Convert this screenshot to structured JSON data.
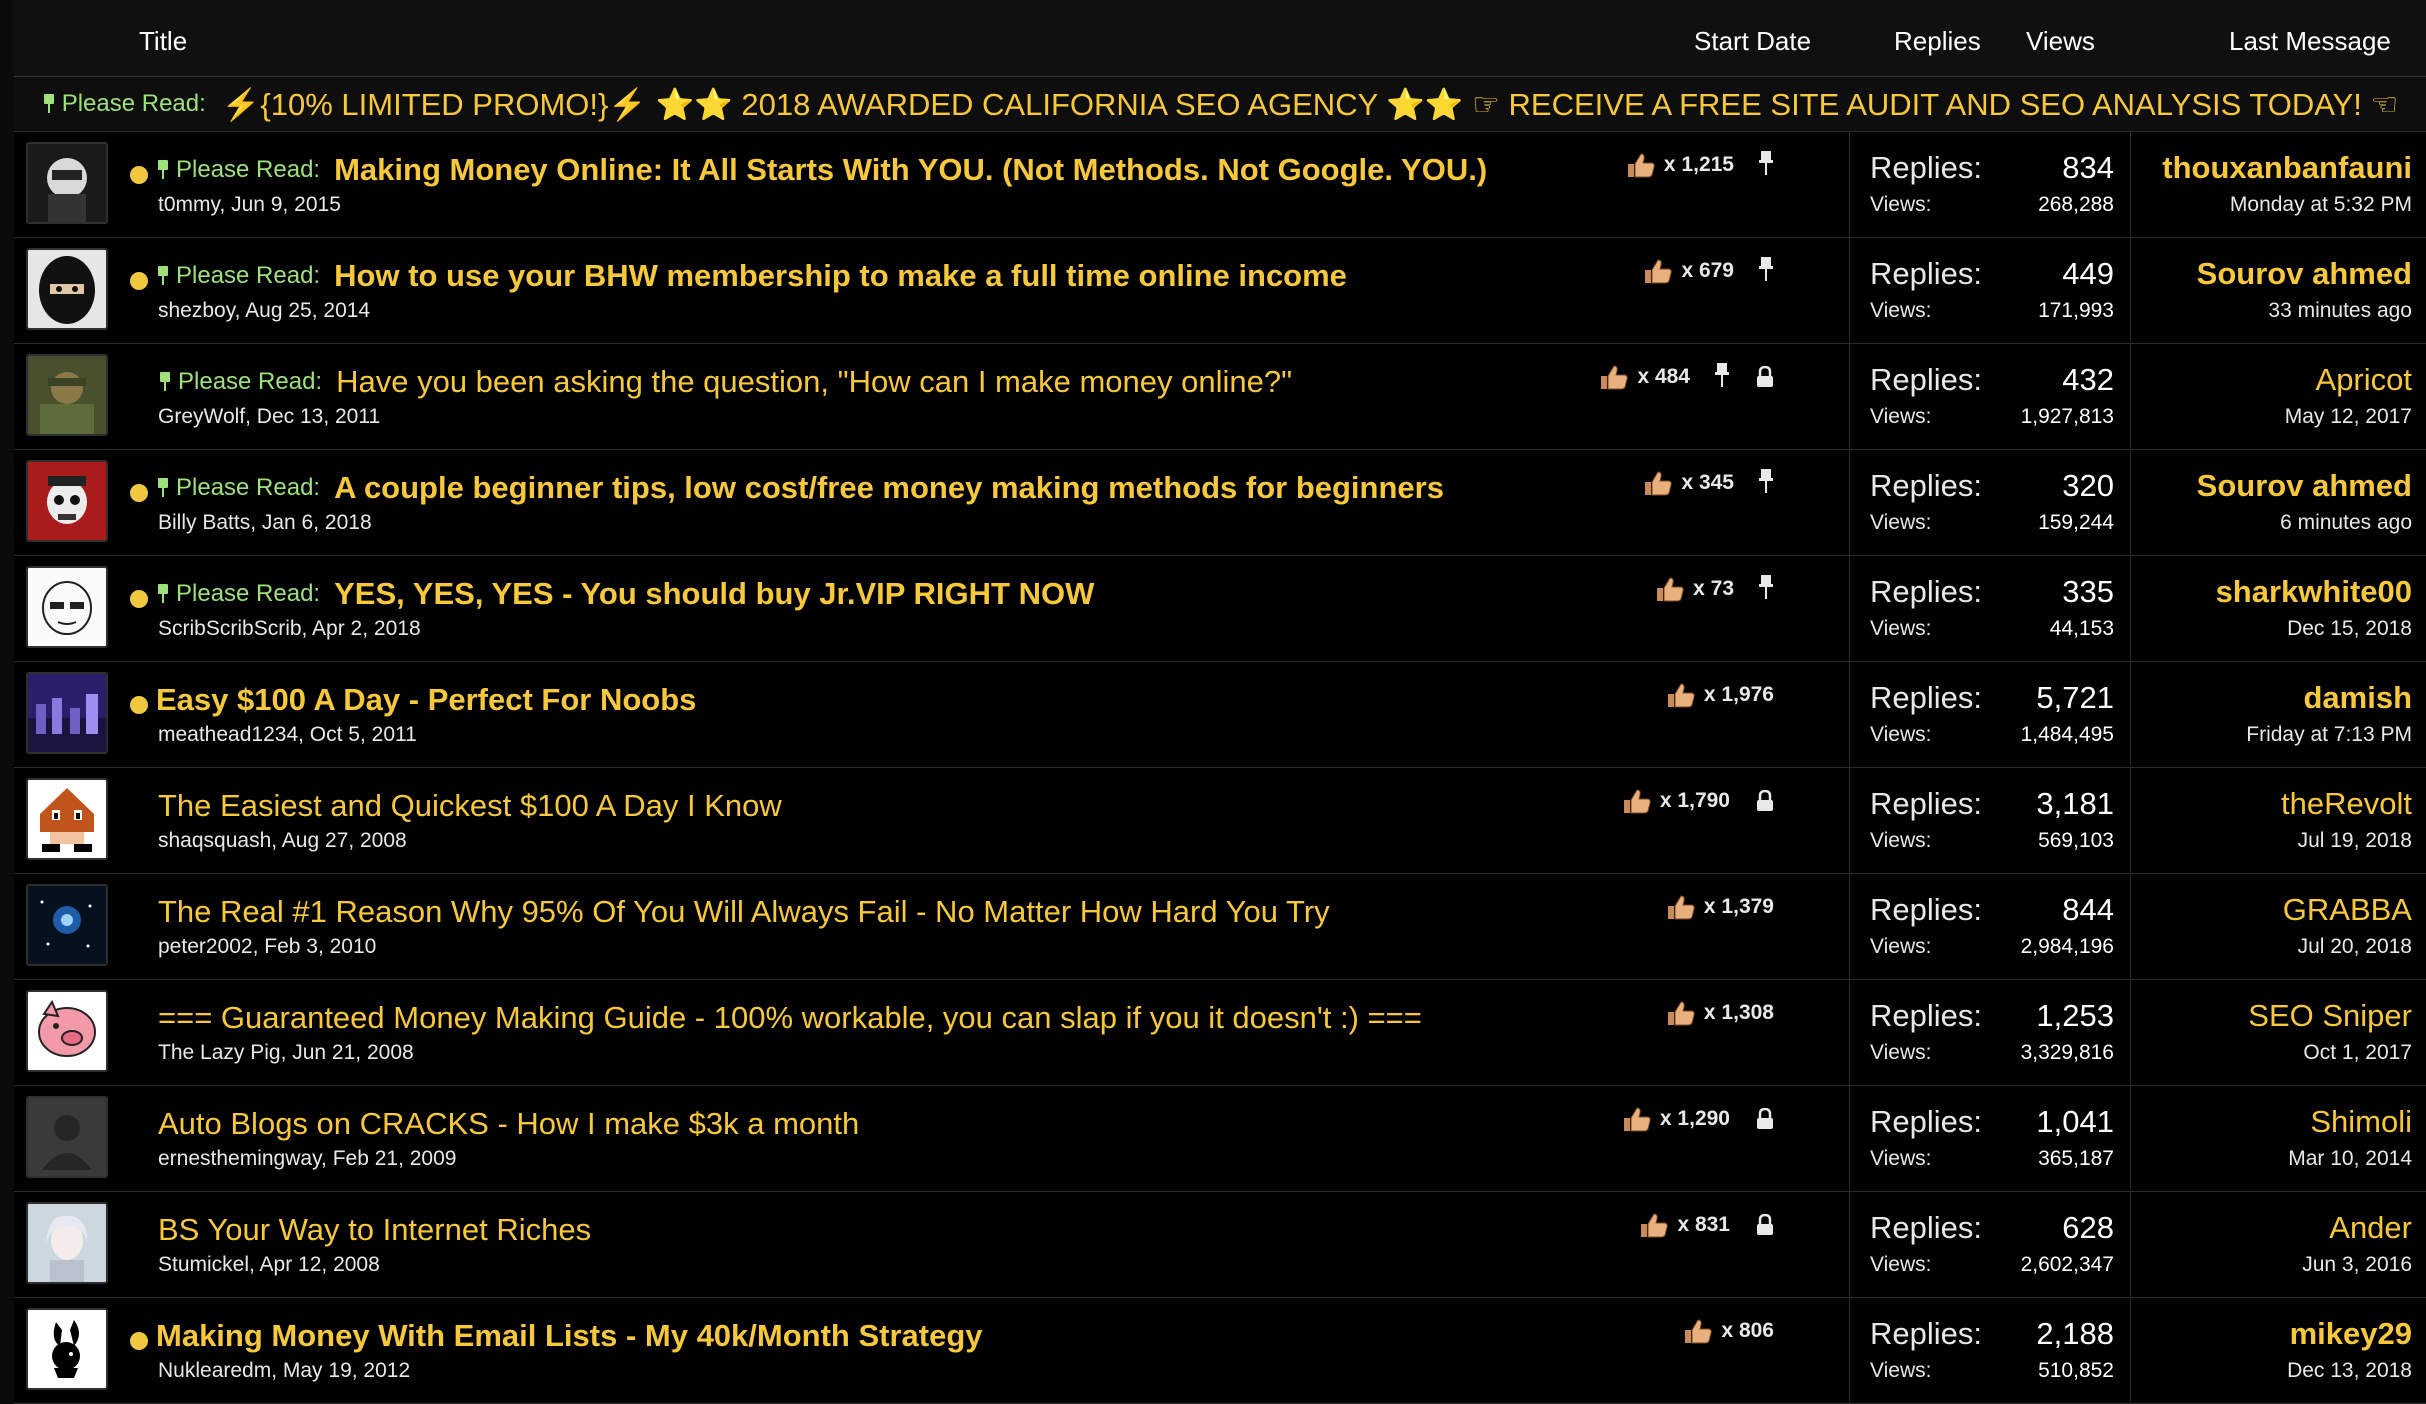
{
  "header": {
    "title": "Title",
    "start_date": "Start Date",
    "replies": "Replies",
    "views": "Views",
    "last_message": "Last Message"
  },
  "promo": {
    "prefix": "Please Read:",
    "text": "⚡{10% LIMITED PROMO!}⚡ ⭐⭐ 2018 AWARDED CALIFORNIA SEO AGENCY ⭐⭐ ☞ RECEIVE A FREE SITE AUDIT AND SEO ANALYSIS TODAY! ☜"
  },
  "labels": {
    "replies": "Replies:",
    "views": "Views:",
    "please_read": "Please Read:"
  },
  "colors": {
    "accent": "#f7c83a",
    "prefix_green": "#9ee07a",
    "background": "#000000"
  },
  "threads": [
    {
      "unread": true,
      "sticky": true,
      "locked": false,
      "bold": true,
      "prefix": "Please Read:",
      "title": "Making Money Online: It All Starts With YOU. (Not Methods. Not Google. YOU.)",
      "author": "t0mmy, Jun 9, 2015",
      "likes": "x 1,215",
      "replies": "834",
      "views": "268,288",
      "last_user": "thouxanbanfauni",
      "last_bold": true,
      "last_time": "Monday at 5:32 PM",
      "avatar": "avatar-masked-figure"
    },
    {
      "unread": true,
      "sticky": true,
      "locked": false,
      "bold": true,
      "prefix": "Please Read:",
      "title": "How to use your BHW membership to make a full time online income",
      "author": "shezboy, Aug 25, 2014",
      "likes": "x 679",
      "replies": "449",
      "views": "171,993",
      "last_user": "Sourov ahmed",
      "last_bold": true,
      "last_time": "33 minutes ago",
      "avatar": "avatar-ninja"
    },
    {
      "unread": false,
      "sticky": true,
      "locked": true,
      "bold": false,
      "prefix": "Please Read:",
      "title": "Have you been asking the question, \"How can I make money online?\"",
      "author": "GreyWolf, Dec 13, 2011",
      "likes": "x 484",
      "replies": "432",
      "views": "1,927,813",
      "last_user": "Apricot",
      "last_bold": false,
      "last_time": "May 12, 2017",
      "avatar": "avatar-soldier"
    },
    {
      "unread": true,
      "sticky": true,
      "locked": false,
      "bold": true,
      "prefix": "Please Read:",
      "title": "A couple beginner tips, low cost/free money making methods for beginners",
      "author": "Billy Batts, Jan 6, 2018",
      "likes": "x 345",
      "replies": "320",
      "views": "159,244",
      "last_user": "Sourov ahmed",
      "last_bold": true,
      "last_time": "6 minutes ago",
      "avatar": "avatar-skull"
    },
    {
      "unread": true,
      "sticky": true,
      "locked": false,
      "bold": true,
      "prefix": "Please Read:",
      "title": "YES, YES, YES - You should buy Jr.VIP RIGHT NOW",
      "author": "ScribScribScrib, Apr 2, 2018",
      "likes": "x 73",
      "replies": "335",
      "views": "44,153",
      "last_user": "sharkwhite00",
      "last_bold": true,
      "last_time": "Dec 15, 2018",
      "avatar": "avatar-sketch-face"
    },
    {
      "unread": true,
      "sticky": false,
      "locked": false,
      "bold": true,
      "prefix": "",
      "title": "Easy $100 A Day - Perfect For Noobs",
      "author": "meathead1234, Oct 5, 2011",
      "likes": "x 1,976",
      "replies": "5,721",
      "views": "1,484,495",
      "last_user": "damish",
      "last_bold": true,
      "last_time": "Friday at 7:13 PM",
      "avatar": "avatar-city-night"
    },
    {
      "unread": false,
      "sticky": false,
      "locked": true,
      "bold": false,
      "prefix": "",
      "title": "The Easiest and Quickest $100 A Day I Know",
      "author": "shaqsquash, Aug 27, 2008",
      "likes": "x 1,790",
      "replies": "3,181",
      "views": "569,103",
      "last_user": "theRevolt",
      "last_bold": false,
      "last_time": "Jul 19, 2018",
      "avatar": "avatar-pixel-goomba"
    },
    {
      "unread": false,
      "sticky": false,
      "locked": false,
      "bold": false,
      "prefix": "",
      "title": "The Real #1 Reason Why 95% Of You Will Always Fail - No Matter How Hard You Try",
      "author": "peter2002, Feb 3, 2010",
      "likes": "x 1,379",
      "replies": "844",
      "views": "2,984,196",
      "last_user": "GRABBA",
      "last_bold": false,
      "last_time": "Jul 20, 2018",
      "avatar": "avatar-galaxy"
    },
    {
      "unread": false,
      "sticky": false,
      "locked": false,
      "bold": false,
      "prefix": "",
      "title": "=== Guaranteed Money Making Guide - 100% workable, you can slap if you it doesn't :) ===",
      "author": "The Lazy Pig, Jun 21, 2008",
      "likes": "x 1,308",
      "replies": "1,253",
      "views": "3,329,816",
      "last_user": "SEO Sniper",
      "last_bold": false,
      "last_time": "Oct 1, 2017",
      "avatar": "avatar-pig"
    },
    {
      "unread": false,
      "sticky": false,
      "locked": true,
      "bold": false,
      "prefix": "",
      "title": "Auto Blogs on CRACKS - How I make $3k a month",
      "author": "ernesthemingway, Feb 21, 2009",
      "likes": "x 1,290",
      "replies": "1,041",
      "views": "365,187",
      "last_user": "Shimoli",
      "last_bold": false,
      "last_time": "Mar 10, 2014",
      "avatar": "avatar-default"
    },
    {
      "unread": false,
      "sticky": false,
      "locked": true,
      "bold": false,
      "prefix": "",
      "title": "BS Your Way to Internet Riches",
      "author": "Stumickel, Apr 12, 2008",
      "likes": "x 831",
      "replies": "628",
      "views": "2,602,347",
      "last_user": "Ander",
      "last_bold": false,
      "last_time": "Jun 3, 2016",
      "avatar": "avatar-woman"
    },
    {
      "unread": true,
      "sticky": false,
      "locked": false,
      "bold": true,
      "prefix": "",
      "title": "Making Money With Email Lists - My 40k/Month Strategy",
      "author": "Nukleare​dm, May 19, 2012",
      "likes": "x 806",
      "replies": "2,188",
      "views": "510,852",
      "last_user": "mikey29",
      "last_bold": true,
      "last_time": "Dec 13, 2018",
      "avatar": "avatar-bunny"
    }
  ]
}
